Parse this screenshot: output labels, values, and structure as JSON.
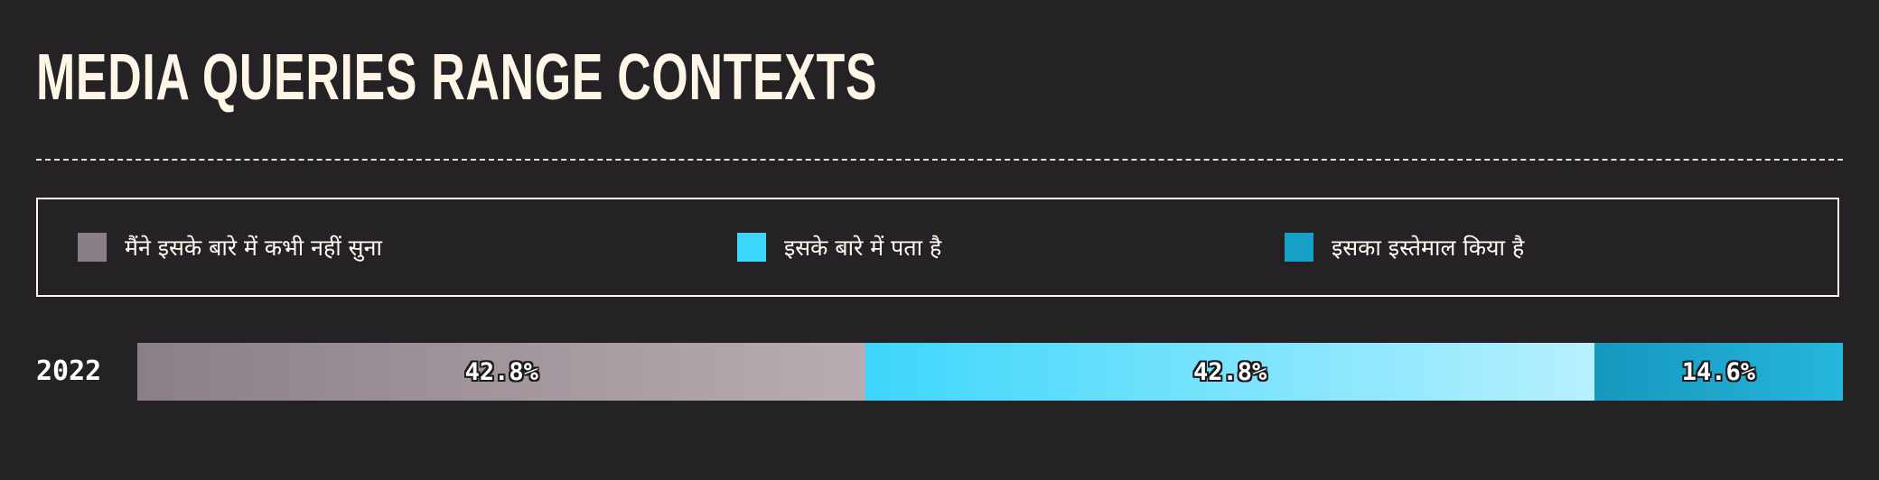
{
  "title": "MEDIA QUERIES RANGE CONTEXTS",
  "colors": {
    "background": "#252225",
    "title": "#fff6e8",
    "never_heard": "#8a7f87",
    "know_about": "#3dd6fb",
    "used": "#16a0c6"
  },
  "legend": [
    {
      "label": "मैंने इसके बारे में कभी नहीं सुना",
      "color": "#8a7f87"
    },
    {
      "label": "इसके बारे में पता है",
      "color": "#3dd6fb"
    },
    {
      "label": "इसका इस्तेमाल किया है",
      "color": "#16a0c6"
    }
  ],
  "chart_data": {
    "type": "bar",
    "orientation": "horizontal-stacked-100",
    "title": "MEDIA QUERIES RANGE CONTEXTS",
    "categories": [
      "2022"
    ],
    "series": [
      {
        "name": "मैंने इसके बारे में कभी नहीं सुना",
        "values": [
          42.8
        ],
        "label": "42.8%"
      },
      {
        "name": "इसके बारे में पता है",
        "values": [
          42.8
        ],
        "label": "42.8%"
      },
      {
        "name": "इसका इस्तेमाल किया है",
        "values": [
          14.6
        ],
        "label": "14.6%"
      }
    ],
    "legend_position": "top",
    "grid": false
  }
}
